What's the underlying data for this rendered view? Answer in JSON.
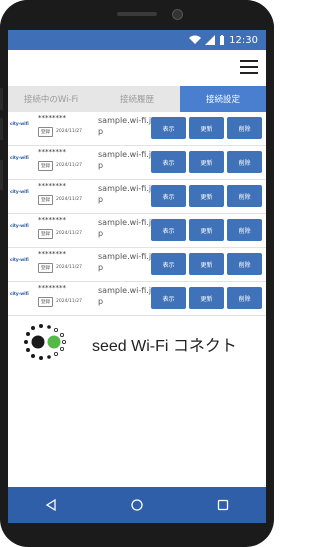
{
  "status": {
    "time": "12:30"
  },
  "tabs": [
    {
      "label": "接続中のWi-Fi",
      "active": false
    },
    {
      "label": "接続履歴",
      "active": false
    },
    {
      "label": "接続設定",
      "active": true
    }
  ],
  "rows": [
    {
      "logo": "city-wifi",
      "ssid": "********",
      "badge": "登録",
      "date": "2024/11/27",
      "host": "sample.wi-fi.jp"
    },
    {
      "logo": "city-wifi",
      "ssid": "********",
      "badge": "登録",
      "date": "2024/11/27",
      "host": "sample.wi-fi.jp"
    },
    {
      "logo": "city-wifi",
      "ssid": "********",
      "badge": "登録",
      "date": "2024/11/27",
      "host": "sample.wi-fi.jp"
    },
    {
      "logo": "city-wifi",
      "ssid": "********",
      "badge": "登録",
      "date": "2024/11/27",
      "host": "sample.wi-fi.jp"
    },
    {
      "logo": "city-wifi",
      "ssid": "********",
      "badge": "登録",
      "date": "2024/11/27",
      "host": "sample.wi-fi.jp"
    },
    {
      "logo": "city-wifi",
      "ssid": "********",
      "badge": "登録",
      "date": "2024/11/27",
      "host": "sample.wi-fi.jp"
    }
  ],
  "buttons": {
    "view": "表示",
    "update": "更新",
    "delete": "削除"
  },
  "brand": {
    "text": "seed Wi-Fi コネクト"
  },
  "colors": {
    "accent": "#3f72b9",
    "nav": "#2f5fa8"
  }
}
